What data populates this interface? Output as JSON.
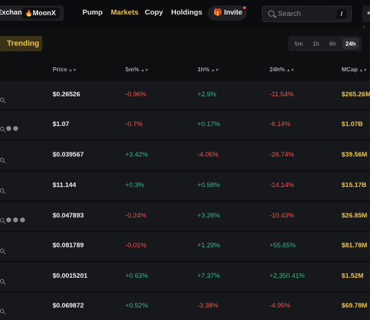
{
  "header": {
    "exchange_label": "Exchange",
    "moonx_label": "MoonX",
    "nav": [
      "Pump",
      "Markets",
      "Copy",
      "Holdings"
    ],
    "active_nav": "Markets",
    "invite_label": "Invite",
    "search_placeholder": "Search",
    "search_shortcut": "/",
    "colors": {
      "accent": "#f0c33c",
      "positive": "#2ebd85",
      "negative": "#f4544e"
    }
  },
  "toolbar": {
    "trending_label": "Trending",
    "timeframes": [
      "5m",
      "1h",
      "6h",
      "24h"
    ],
    "active_timeframe": "24h"
  },
  "table": {
    "columns": [
      "Price",
      "5m%",
      "1h%",
      "24h%",
      "MCap"
    ],
    "rows": [
      {
        "price": "$0.26526",
        "m5": "-0.96%",
        "h1": "+2.9%",
        "h24": "-11.54%",
        "mcap": "$265.26M",
        "icons": [
          "search-icon"
        ]
      },
      {
        "price": "$1.07",
        "m5": "-0.7%",
        "h1": "+0.17%",
        "h24": "-6.14%",
        "mcap": "$1.07B",
        "icons": [
          "search-icon",
          "social-icon",
          "social-icon"
        ]
      },
      {
        "price": "$0.039567",
        "m5": "+3.42%",
        "h1": "-4.05%",
        "h24": "-26.74%",
        "mcap": "$39.56M",
        "icons": [
          "search-icon"
        ]
      },
      {
        "price": "$11.144",
        "m5": "+0.3%",
        "h1": "+0.58%",
        "h24": "-14.14%",
        "mcap": "$15.17B",
        "icons": [
          "search-icon"
        ]
      },
      {
        "price": "$0.047893",
        "m5": "-0.24%",
        "h1": "+3.28%",
        "h24": "-10.43%",
        "mcap": "$26.85M",
        "icons": [
          "search-icon",
          "social-icon",
          "social-icon",
          "social-icon"
        ]
      },
      {
        "price": "$0.081789",
        "m5": "-0.01%",
        "h1": "+1.29%",
        "h24": "+55.65%",
        "mcap": "$81.78M",
        "icons": [
          "search-icon"
        ]
      },
      {
        "price": "$0.0015201",
        "m5": "+0.63%",
        "h1": "+7.37%",
        "h24": "+2,350.41%",
        "mcap": "$1.52M",
        "icons": [
          "search-icon"
        ]
      },
      {
        "price": "$0.069872",
        "m5": "+0.52%",
        "h1": "-3.38%",
        "h24": "-4.95%",
        "mcap": "$69.78M",
        "icons": [
          "search-icon"
        ]
      }
    ]
  }
}
